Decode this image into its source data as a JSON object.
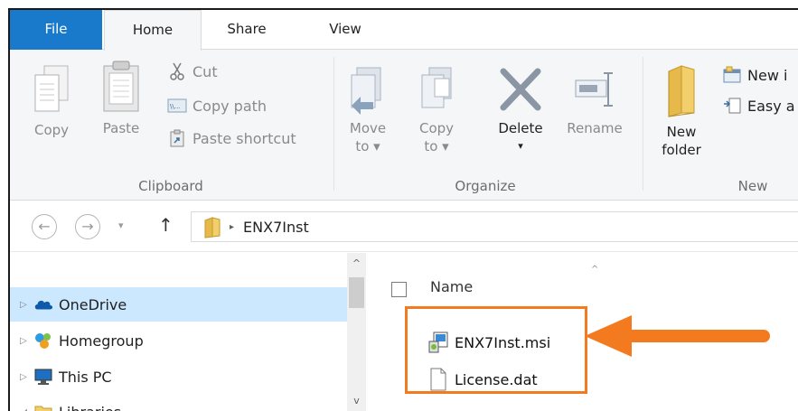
{
  "tabs": {
    "file": "File",
    "home": "Home",
    "share": "Share",
    "view": "View"
  },
  "clipboard": {
    "copy": "Copy",
    "paste": "Paste",
    "cut": "Cut",
    "copy_path": "Copy path",
    "paste_shortcut": "Paste shortcut",
    "group_label": "Clipboard"
  },
  "organize": {
    "move_to_line1": "Move",
    "move_to_line2": "to ▾",
    "copy_to_line1": "Copy",
    "copy_to_line2": "to ▾",
    "delete": "Delete",
    "delete_arrow": "▾",
    "rename": "Rename",
    "group_label": "Organize"
  },
  "new": {
    "new_folder_line1": "New",
    "new_folder_line2": "folder",
    "new_item": "New i",
    "easy_access": "Easy a",
    "group_label": "New"
  },
  "address": {
    "back": "←",
    "forward": "→",
    "recent": "▾",
    "up": "↑",
    "breadcrumb_sep": "▸",
    "path": "ENX7Inst"
  },
  "nav_pane": {
    "items": [
      {
        "label": "OneDrive",
        "expander": "▷"
      },
      {
        "label": "Homegroup",
        "expander": "▷"
      },
      {
        "label": "This PC",
        "expander": "▷"
      },
      {
        "label": "Libraries",
        "expander": "◢"
      }
    ],
    "scroll_up": "^",
    "scroll_down": "v"
  },
  "content": {
    "column_name": "Name",
    "sort_indicator": "^",
    "files": [
      {
        "name": "ENX7Inst.msi",
        "icon": "msi-installer-icon"
      },
      {
        "name": "License.dat",
        "icon": "document-icon"
      }
    ]
  },
  "colors": {
    "file_tab": "#1979ca",
    "ribbon_bg": "#f5f6f7",
    "selected_nav": "#cce8ff",
    "annotation": "#f47a20"
  }
}
